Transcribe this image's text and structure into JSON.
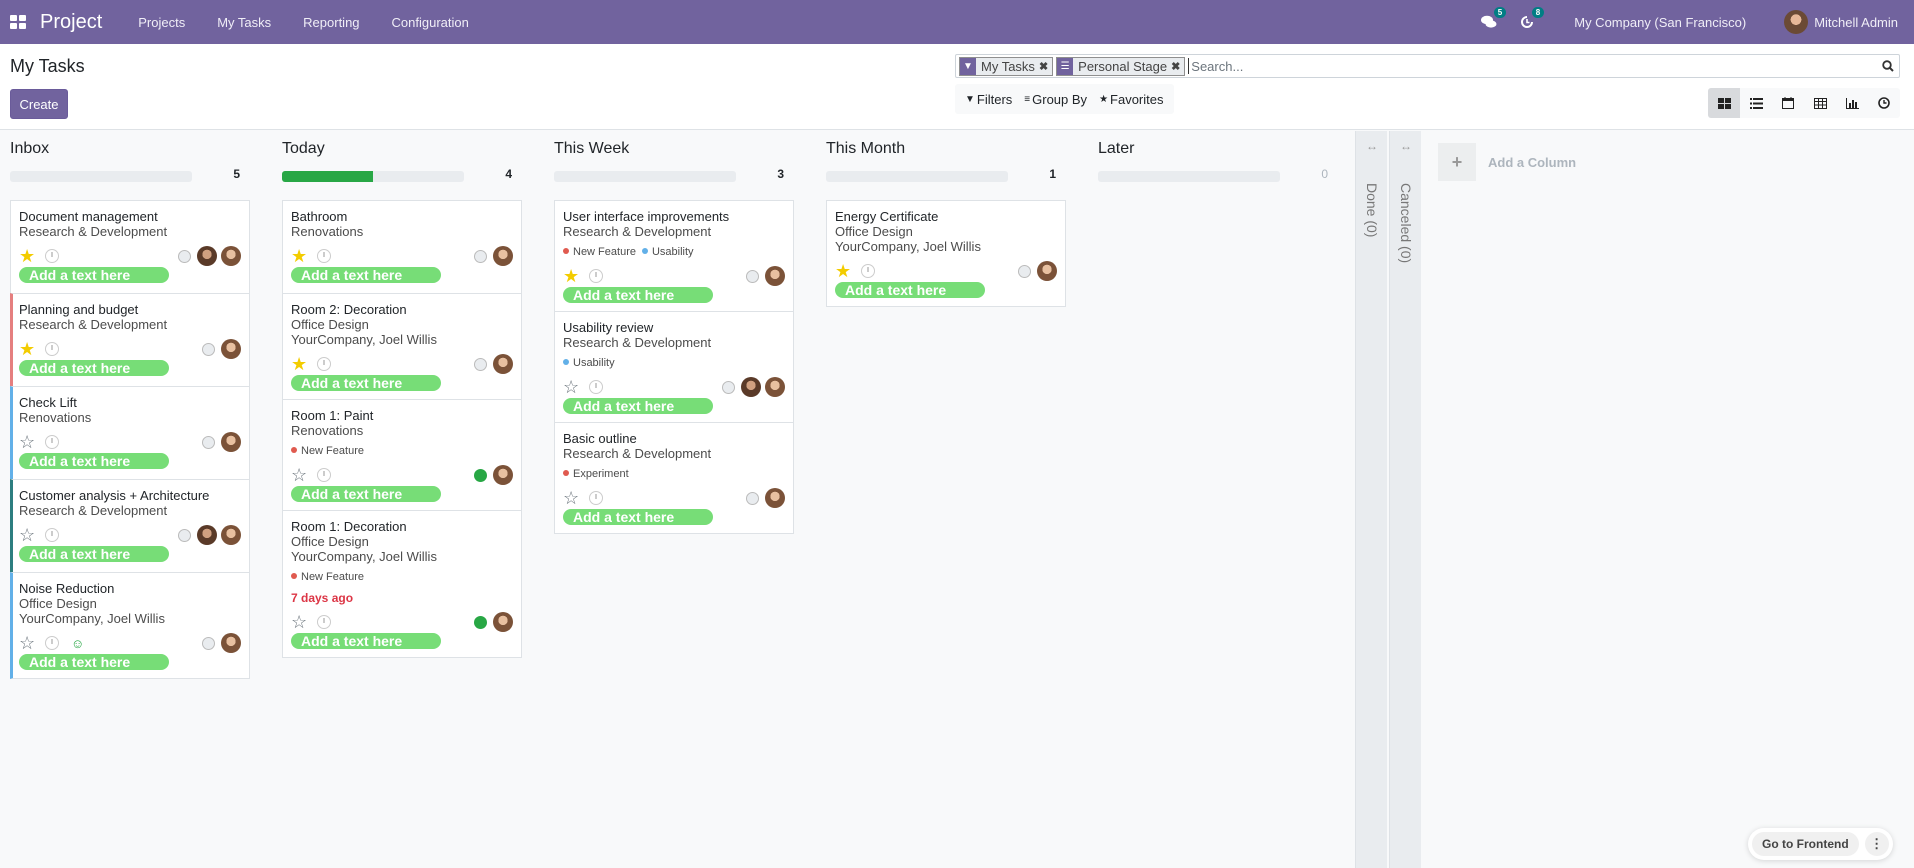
{
  "navbar": {
    "brand": "Project",
    "menu": [
      "Projects",
      "My Tasks",
      "Reporting",
      "Configuration"
    ],
    "messages_count": "5",
    "activities_count": "8",
    "company": "My Company (San Francisco)",
    "user": "Mitchell Admin"
  },
  "control_panel": {
    "title": "My Tasks",
    "create_label": "Create",
    "facets": [
      {
        "icon": "filter-icon",
        "label": "My Tasks"
      },
      {
        "icon": "group-by-icon",
        "label": "Personal Stage"
      }
    ],
    "search_placeholder": "Search...",
    "filters_label": "Filters",
    "group_by_label": "Group By",
    "favorites_label": "Favorites",
    "views": [
      "kanban",
      "list",
      "calendar",
      "pivot",
      "graph",
      "activity"
    ],
    "active_view": "kanban"
  },
  "columns": [
    {
      "title": "Inbox",
      "count": "5",
      "progress_green": 0,
      "cards": [
        {
          "title": "Document management",
          "lines": [
            "Research & Development"
          ],
          "tags": [],
          "starred": true,
          "state": "grey",
          "avatars": 2,
          "add_text": "Add a text here",
          "border": ""
        },
        {
          "title": "Planning and budget",
          "lines": [
            "Research & Development"
          ],
          "tags": [],
          "starred": true,
          "state": "grey",
          "avatars": 1,
          "add_text": "Add a text here",
          "border": "red"
        },
        {
          "title": "Check Lift",
          "lines": [
            "Renovations"
          ],
          "tags": [],
          "starred": false,
          "state": "grey",
          "avatars": 1,
          "add_text": "Add a text here",
          "border": "blue"
        },
        {
          "title": "Customer analysis + Architecture",
          "lines": [
            "Research & Development"
          ],
          "tags": [],
          "starred": false,
          "state": "grey",
          "avatars": 2,
          "add_text": "Add a text here",
          "border": "teal"
        },
        {
          "title": "Noise Reduction",
          "lines": [
            "Office Design",
            "YourCompany, Joel Willis"
          ],
          "tags": [],
          "starred": false,
          "state": "grey",
          "avatars": 1,
          "smiley": true,
          "add_text": "Add a text here",
          "border": "blue"
        }
      ]
    },
    {
      "title": "Today",
      "count": "4",
      "progress_green": 0.5,
      "cards": [
        {
          "title": "Bathroom",
          "lines": [
            "Renovations"
          ],
          "tags": [],
          "starred": true,
          "state": "grey",
          "avatars": 1,
          "add_text": "Add a text here",
          "border": ""
        },
        {
          "title": "Room 2: Decoration",
          "lines": [
            "Office Design",
            "YourCompany, Joel Willis"
          ],
          "tags": [],
          "starred": true,
          "state": "grey",
          "avatars": 1,
          "add_text": "Add a text here",
          "border": ""
        },
        {
          "title": "Room 1: Paint",
          "lines": [
            "Renovations"
          ],
          "tags": [
            {
              "label": "New Feature",
              "color": "#e05a4f"
            }
          ],
          "starred": false,
          "state": "green",
          "avatars": 1,
          "add_text": "Add a text here",
          "border": ""
        },
        {
          "title": "Room 1: Decoration",
          "lines": [
            "Office Design",
            "YourCompany, Joel Willis"
          ],
          "tags": [
            {
              "label": "New Feature",
              "color": "#e05a4f"
            }
          ],
          "deadline": "7 days ago",
          "starred": false,
          "state": "green",
          "avatars": 1,
          "add_text": "Add a text here",
          "border": ""
        }
      ]
    },
    {
      "title": "This Week",
      "count": "3",
      "progress_green": 0,
      "cards": [
        {
          "title": "User interface improvements",
          "lines": [
            "Research & Development"
          ],
          "tags": [
            {
              "label": "New Feature",
              "color": "#e05a4f"
            },
            {
              "label": "Usability",
              "color": "#62b0e8"
            }
          ],
          "starred": true,
          "state": "grey",
          "avatars": 1,
          "add_text": "Add a text here",
          "border": ""
        },
        {
          "title": "Usability review",
          "lines": [
            "Research & Development"
          ],
          "tags": [
            {
              "label": "Usability",
              "color": "#62b0e8"
            }
          ],
          "starred": false,
          "state": "grey",
          "avatars": 2,
          "add_text": "Add a text here",
          "border": ""
        },
        {
          "title": "Basic outline",
          "lines": [
            "Research & Development"
          ],
          "tags": [
            {
              "label": "Experiment",
              "color": "#e05a4f"
            }
          ],
          "starred": false,
          "state": "grey",
          "avatars": 1,
          "add_text": "Add a text here",
          "border": ""
        }
      ]
    },
    {
      "title": "This Month",
      "count": "1",
      "progress_green": 0,
      "cards": [
        {
          "title": "Energy Certificate",
          "lines": [
            "Office Design",
            "YourCompany, Joel Willis"
          ],
          "tags": [],
          "starred": true,
          "state": "grey",
          "avatars": 1,
          "add_text": "Add a text here",
          "border": ""
        }
      ]
    },
    {
      "title": "Later",
      "count": "0",
      "progress_green": 0,
      "cards": []
    }
  ],
  "folded_columns": [
    "Done (0)",
    "Canceled (0)"
  ],
  "add_column_label": "Add a Column",
  "go_to_frontend_label": "Go to Frontend"
}
